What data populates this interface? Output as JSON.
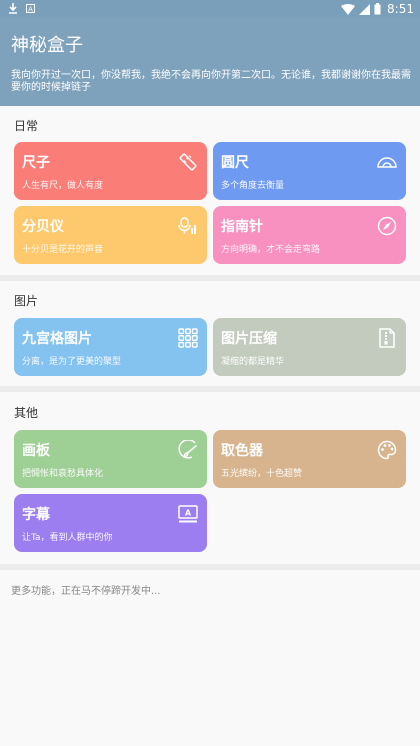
{
  "status_bar": {
    "time": "8:51",
    "icons": [
      "download-icon",
      "a-icon",
      "wifi-icon",
      "signal-icon",
      "battery-icon"
    ]
  },
  "header": {
    "title": "神秘盒子",
    "subtitle": "我向你开过一次口，你没帮我，我绝不会再向你开第二次口。无论谁，我都谢谢你在我最需要你的时候掉链子"
  },
  "sections": [
    {
      "title": "日常",
      "cards": [
        {
          "title": "尺子",
          "desc": "人生有尺，做人有度",
          "icon": "ruler-icon",
          "color": "#fa7d77"
        },
        {
          "title": "圆尺",
          "desc": "多个角度去衡量",
          "icon": "protractor-icon",
          "color": "#6e9af2"
        },
        {
          "title": "分贝仪",
          "desc": "十分贝是花开的声音",
          "icon": "decibel-icon",
          "color": "#fec86c"
        },
        {
          "title": "指南针",
          "desc": "方向明确，才不会走弯路",
          "icon": "compass-icon",
          "color": "#f890c0"
        }
      ]
    },
    {
      "title": "图片",
      "cards": [
        {
          "title": "九宫格图片",
          "desc": "分离，是为了更美的聚型",
          "icon": "grid-icon",
          "color": "#84c2f0"
        },
        {
          "title": "图片压缩",
          "desc": "凝缩的都是精华",
          "icon": "compress-icon",
          "color": "#c3cbbf"
        }
      ]
    },
    {
      "title": "其他",
      "cards": [
        {
          "title": "画板",
          "desc": "把惆怅和哀愁具体化",
          "icon": "brush-icon",
          "color": "#9ecf95"
        },
        {
          "title": "取色器",
          "desc": "五光缤纷，十色超赞",
          "icon": "palette-icon",
          "color": "#d7b48e"
        },
        {
          "title": "字幕",
          "desc": "让Ta，看到人群中的你",
          "icon": "subtitle-icon",
          "color": "#9c7ef0"
        }
      ]
    }
  ],
  "footer": {
    "text": "更多功能，正在马不停蹄开发中..."
  }
}
